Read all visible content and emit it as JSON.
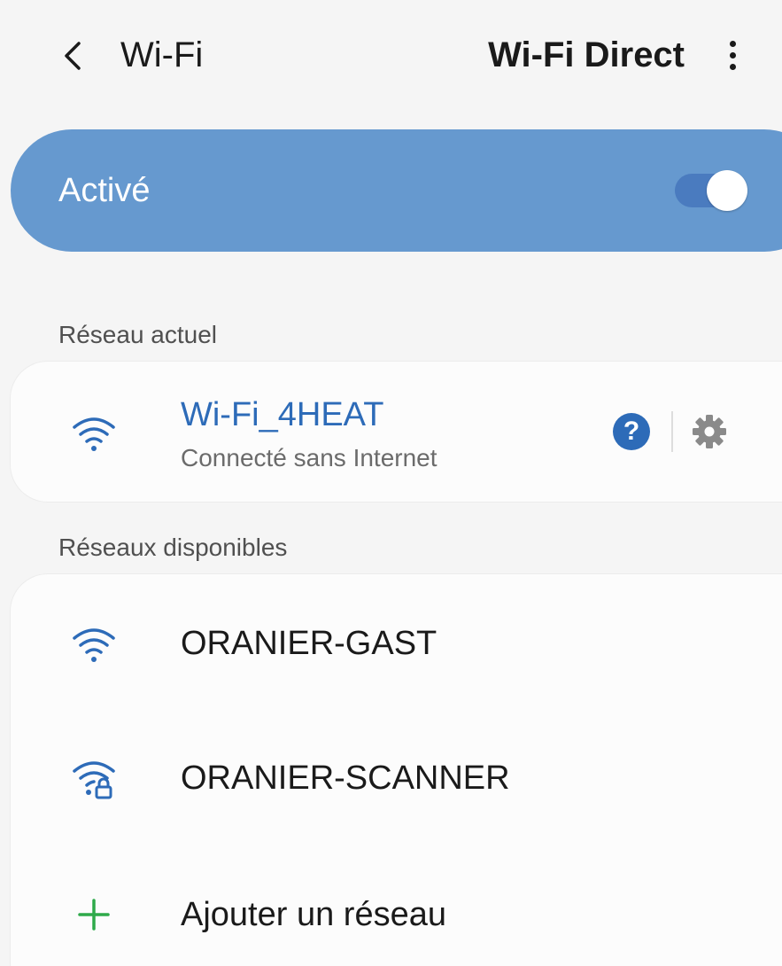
{
  "header": {
    "title": "Wi-Fi",
    "action": "Wi-Fi Direct",
    "back_icon": "chevron-left-icon",
    "more_icon": "more-vertical-icon"
  },
  "master_toggle": {
    "label": "Activé",
    "state": "on",
    "bar_color": "#6699cf"
  },
  "current_network": {
    "section_label": "Réseau actuel",
    "name": "Wi-Fi_4HEAT",
    "status": "Connecté sans Internet",
    "icon": "wifi-icon",
    "name_color": "#2d6bb8",
    "help_label": "?",
    "settings_icon": "gear-icon"
  },
  "available_networks": {
    "section_label": "Réseaux disponibles",
    "items": [
      {
        "name": "ORANIER-GAST",
        "icon": "wifi-icon",
        "secured": false
      },
      {
        "name": "ORANIER-SCANNER",
        "icon": "wifi-lock-icon",
        "secured": true
      }
    ],
    "add_label": "Ajouter un réseau",
    "add_icon": "plus-icon",
    "add_color": "#2eaa4a"
  }
}
